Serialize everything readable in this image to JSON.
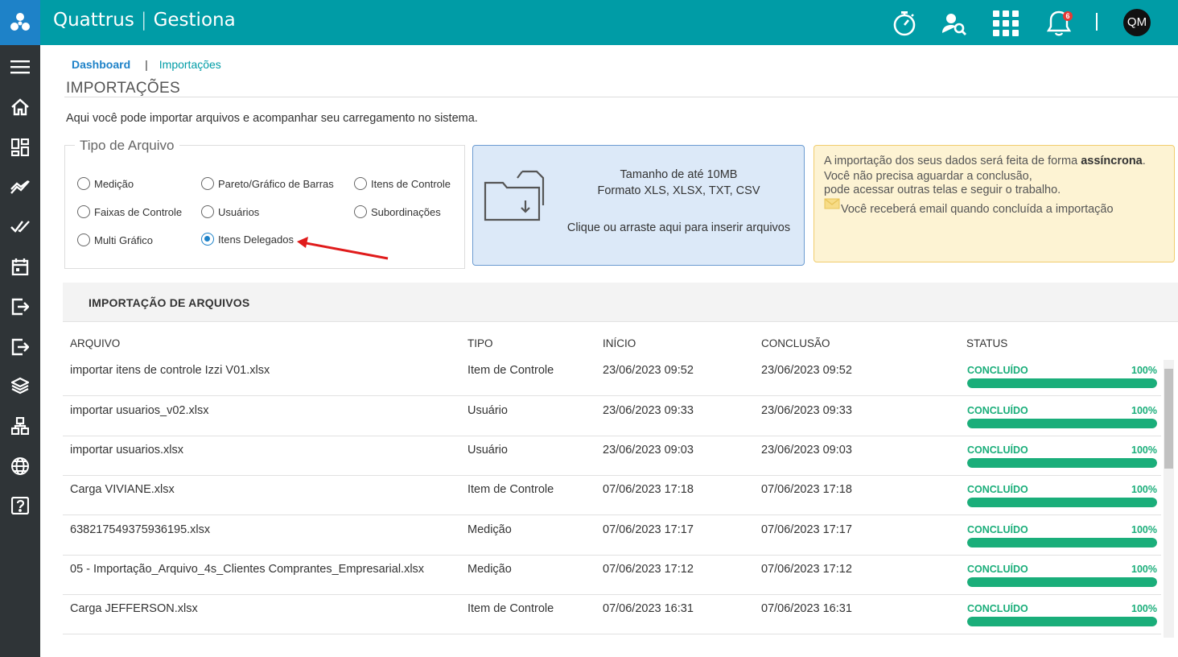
{
  "header": {
    "brand": "Quattrus",
    "brand_sep": "|",
    "product": "Gestiona",
    "notification_count": "6",
    "user_initials": "QM",
    "accent": "#009ca6"
  },
  "sidebar": {
    "items": [
      "menu-icon",
      "home-icon",
      "dashboard-icon",
      "chart-icon",
      "double-check-icon",
      "calendar-icon",
      "import-icon",
      "export-icon",
      "layers-icon",
      "hierarchy-icon",
      "globe-icon",
      "help-icon"
    ]
  },
  "breadcrumb": {
    "home": "Dashboard",
    "separator": "|",
    "current": "Importações"
  },
  "page": {
    "title": "IMPORTAÇÕES",
    "intro": "Aqui você pode importar arquivos e acompanhar seu carregamento no sistema."
  },
  "file_type": {
    "legend": "Tipo de Arquivo",
    "options": [
      {
        "label": "Medição",
        "selected": false
      },
      {
        "label": "Pareto/Gráfico de Barras",
        "selected": false
      },
      {
        "label": "Itens de Controle",
        "selected": false
      },
      {
        "label": "Faixas de Controle",
        "selected": false
      },
      {
        "label": "Usuários",
        "selected": false
      },
      {
        "label": "Subordinações",
        "selected": false
      },
      {
        "label": "Multi Gráfico",
        "selected": false
      },
      {
        "label": "Itens Delegados",
        "selected": true
      }
    ]
  },
  "dropzone": {
    "size": "Tamanho de até 10MB",
    "formats": "Formato XLS, XLSX, TXT, CSV",
    "hint": "Clique ou arraste aqui para inserir arquivos"
  },
  "info": {
    "line1_pre": "A importação dos seus dados será feita de forma ",
    "line1_bold": "assíncrona",
    "line1_post": ".",
    "line2": "Você não precisa aguardar a conclusão,",
    "line3": "pode acessar outras telas e seguir o trabalho.",
    "line4": "Você receberá email quando concluída a importação"
  },
  "table": {
    "title": "IMPORTAÇÃO DE ARQUIVOS",
    "headers": {
      "file": "ARQUIVO",
      "type": "TIPO",
      "start": "INÍCIO",
      "end": "CONCLUSÃO",
      "status": "STATUS"
    },
    "rows": [
      {
        "file": "importar itens de controle Izzi V01.xlsx",
        "type": "Item de Controle",
        "start": "23/06/2023 09:52",
        "end": "23/06/2023 09:52",
        "status": "CONCLUÍDO",
        "percent": "100%",
        "progress": 1.0
      },
      {
        "file": "importar usuarios_v02.xlsx",
        "type": "Usuário",
        "start": "23/06/2023 09:33",
        "end": "23/06/2023 09:33",
        "status": "CONCLUÍDO",
        "percent": "100%",
        "progress": 1.0
      },
      {
        "file": "importar usuarios.xlsx",
        "type": "Usuário",
        "start": "23/06/2023 09:03",
        "end": "23/06/2023 09:03",
        "status": "CONCLUÍDO",
        "percent": "100%",
        "progress": 1.0
      },
      {
        "file": "Carga VIVIANE.xlsx",
        "type": "Item de Controle",
        "start": "07/06/2023 17:18",
        "end": "07/06/2023 17:18",
        "status": "CONCLUÍDO",
        "percent": "100%",
        "progress": 1.0
      },
      {
        "file": "638217549375936195.xlsx",
        "type": "Medição",
        "start": "07/06/2023 17:17",
        "end": "07/06/2023 17:17",
        "status": "CONCLUÍDO",
        "percent": "100%",
        "progress": 1.0
      },
      {
        "file": "05 - Importação_Arquivo_4s_Clientes Comprantes_Empresarial.xlsx",
        "type": "Medição",
        "start": "07/06/2023 17:12",
        "end": "07/06/2023 17:12",
        "status": "CONCLUÍDO",
        "percent": "100%",
        "progress": 1.0
      },
      {
        "file": "Carga JEFFERSON.xlsx",
        "type": "Item de Controle",
        "start": "07/06/2023 16:31",
        "end": "07/06/2023 16:31",
        "status": "CONCLUÍDO",
        "percent": "100%",
        "progress": 1.0
      }
    ]
  }
}
